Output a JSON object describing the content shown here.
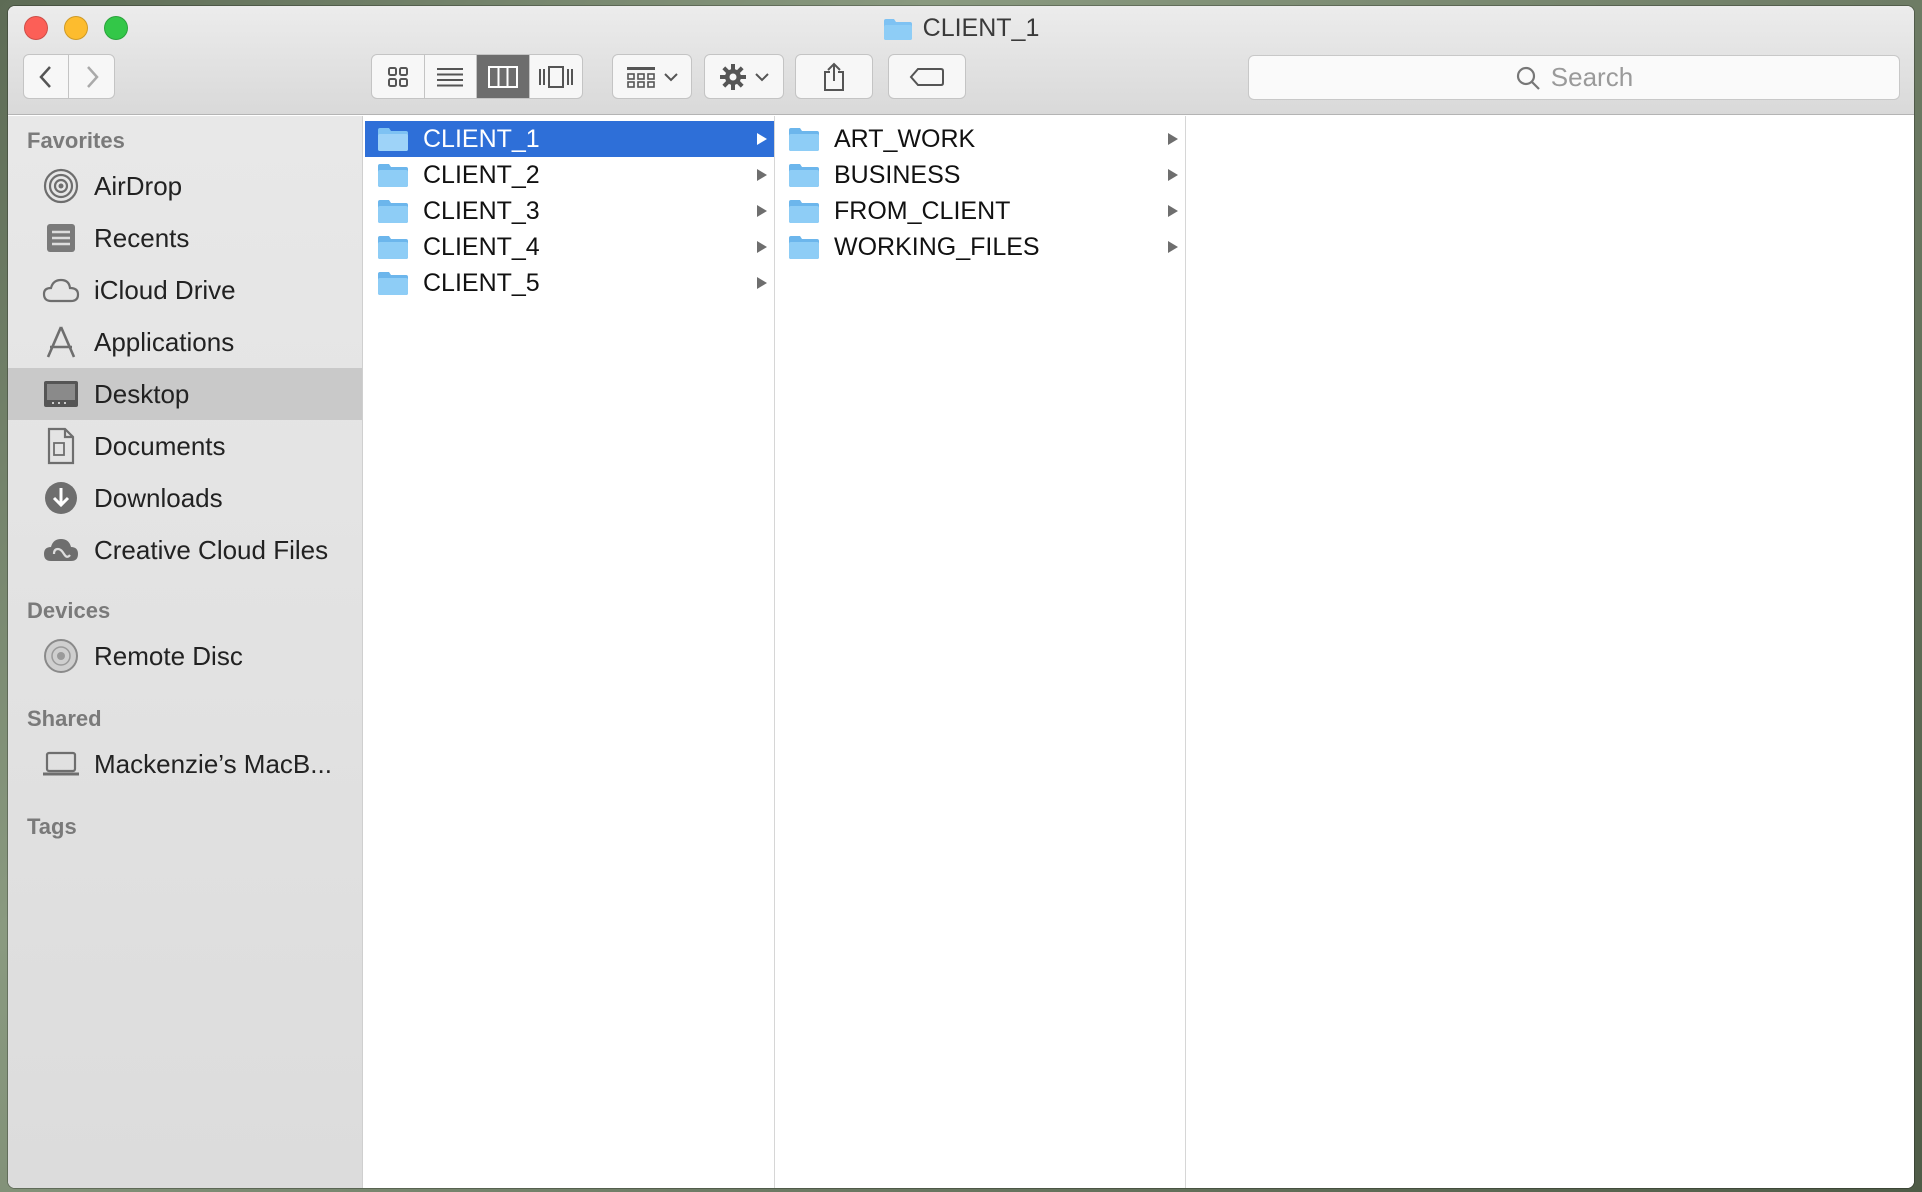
{
  "window": {
    "title": "CLIENT_1"
  },
  "toolbar": {
    "search_placeholder": "Search",
    "view_modes": [
      "icon-view",
      "list-view",
      "column-view",
      "cover-flow-view"
    ],
    "active_view": "column-view"
  },
  "sidebar": {
    "sections": [
      {
        "heading": "Favorites",
        "items": [
          {
            "label": "AirDrop",
            "icon": "airdrop-icon"
          },
          {
            "label": "Recents",
            "icon": "recents-icon"
          },
          {
            "label": "iCloud Drive",
            "icon": "cloud-icon"
          },
          {
            "label": "Applications",
            "icon": "applications-icon"
          },
          {
            "label": "Desktop",
            "icon": "desktop-icon",
            "selected": true
          },
          {
            "label": "Documents",
            "icon": "documents-icon"
          },
          {
            "label": "Downloads",
            "icon": "downloads-icon"
          },
          {
            "label": "Creative Cloud Files",
            "icon": "creative-cloud-icon"
          }
        ]
      },
      {
        "heading": "Devices",
        "items": [
          {
            "label": "Remote Disc",
            "icon": "disc-icon"
          }
        ]
      },
      {
        "heading": "Shared",
        "items": [
          {
            "label": "Mackenzie’s MacB...",
            "icon": "laptop-icon"
          }
        ]
      },
      {
        "heading": "Tags",
        "items": []
      }
    ]
  },
  "columns": [
    {
      "items": [
        {
          "label": "CLIENT_1",
          "selected": true
        },
        {
          "label": "CLIENT_2"
        },
        {
          "label": "CLIENT_3"
        },
        {
          "label": "CLIENT_4"
        },
        {
          "label": "CLIENT_5"
        }
      ]
    },
    {
      "items": [
        {
          "label": "ART_WORK"
        },
        {
          "label": "BUSINESS"
        },
        {
          "label": "FROM_CLIENT"
        },
        {
          "label": "WORKING_FILES"
        }
      ]
    },
    {
      "items": []
    }
  ],
  "colors": {
    "selection": "#2e6fd8",
    "folder": "#7ec2f3",
    "sidebar_selected": "#c9c9c9"
  }
}
